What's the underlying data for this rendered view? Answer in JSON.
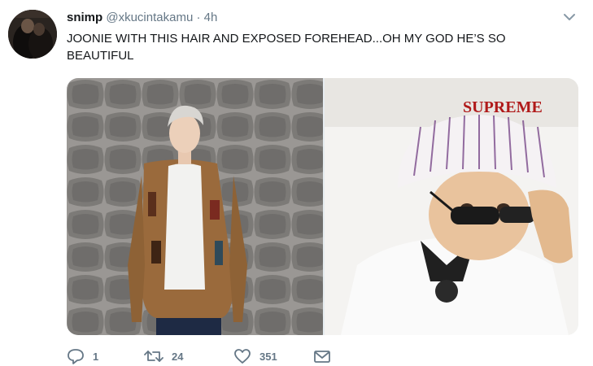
{
  "tweet": {
    "display_name": "snimp",
    "handle": "@xkucintakamu",
    "separator": "·",
    "time": "4h",
    "text": "JOONIE WITH THIS HAIR AND EXPOSED FOREHEAD...OH MY GOD HE’S SO BEAUTIFUL",
    "hat_text": "SUPREME"
  },
  "actions": {
    "reply_count": "1",
    "retweet_count": "24",
    "like_count": "351"
  },
  "icons": {
    "reply": "reply-icon",
    "retweet": "retweet-icon",
    "like": "heart-icon",
    "dm": "envelope-icon",
    "more": "chevron-down-icon"
  },
  "colors": {
    "text": "#14171a",
    "secondary": "#657786"
  }
}
